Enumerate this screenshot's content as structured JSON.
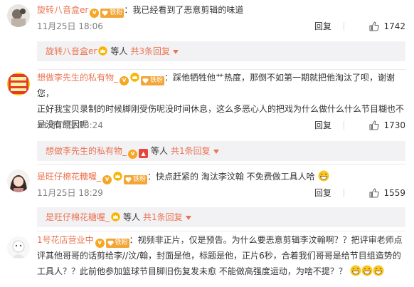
{
  "comments": [
    {
      "user": "旋转八音盒er",
      "fan_badge": "铁粉",
      "text": "：我已经看到了恶意剪辑的味道",
      "time": "11月25日 18:06",
      "reply_label": "回复",
      "likes": "1742",
      "sub_user": "旋转八音盒er",
      "sub_etc": "等人",
      "sub_more": "共3条回复"
    },
    {
      "user": "想做李先生的私有物_",
      "fan_badge": "铁粉",
      "text_lines": [
        "：踩他牺牲他艹热度，那倒不如第一期就把他淘汰了呗，谢谢您，",
        "正好我宝贝录制的时候脚刚受伤呢没时间休息，这么多恶心人的把戏为什么做什么什么节目糊也不",
        "是没有原因呢"
      ],
      "time": "11月25日 18:24",
      "reply_label": "回复",
      "likes": "1730",
      "sub_user": "想做李先生的私有物_",
      "sub_etc": "等人",
      "sub_more": "共1条回复"
    },
    {
      "user": "是旺仔棉花糖喔_",
      "fan_badge": "铁粉",
      "text": "：快点赶紧的 淘汰李汶翰 不免费做工具人哈",
      "time": "11月25日 18:29",
      "reply_label": "回复",
      "likes": "1559",
      "sub_user": "是旺仔棉花糖喔_",
      "sub_etc": "等人",
      "sub_more": "共1条回复"
    },
    {
      "user": "1号花店营业中",
      "fan_badge": "铁粉",
      "text_lines": [
        "：视频非正片，仅是预告。为什么要恶意剪辑李汶翰啊？？把评审老师点",
        "评其他哥哥的话剪给李//汶/翰，封面是他，标题是他，正片6秒，合着我们哥哥是给节目组造势的",
        "工具人？？此前他参加篮球节目脚旧伤复发未愈 不能做高强度运动，为啥不提？？"
      ]
    }
  ],
  "colors": {
    "username": "#eb7350",
    "text": "#333333",
    "meta": "#808080",
    "subbox_bg": "#f2f2f5",
    "fan_badge": "#f3a536",
    "vip": "#f6a623"
  },
  "icons": [
    "avatar",
    "vip-badge-icon",
    "crown-icon",
    "fan-badge-heart-icon",
    "thumbs-up-icon",
    "arrow-down-icon",
    "grin-emoji-icon"
  ]
}
